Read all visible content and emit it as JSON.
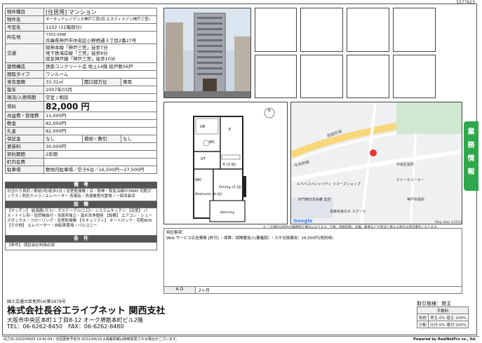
{
  "doc_id": "5577623",
  "property": {
    "type_label": "物件種目",
    "type_value": "[住居用] マンション",
    "name_label": "物件名",
    "name_value": "オーキッドレジデンス神戸三宮(旧:エスティメゾン神戸三宮)",
    "room_label": "号室名",
    "room_value": "1102 (11階部分)",
    "addr_label": "所在地",
    "addr_zip": "〒651-0088",
    "addr_value": "兵庫県神戸市中央区小野柄通３丁目2番27号",
    "transit_label": "交通",
    "transit": [
      "阪神本線「神戸三宮」徒歩7分",
      "地下鉄海岸線「三宮」徒歩8分",
      "阪急神戸線「神戸三宮」徒歩10分"
    ],
    "structure_label": "建物構造",
    "structure_value": "鉄筋コンクリート造 地上14階 総戸数56戸",
    "layout_label": "間取タイプ",
    "layout_value": "ワンルーム",
    "area_label": "専有面積",
    "area_value": "33.31㎡",
    "dir_label": "開口部方位",
    "dir_value": "東南",
    "built_label": "築年",
    "built_value": "2007年03月",
    "status_label": "現況/入居時期",
    "status_value": "空室 / 相談",
    "rent_label": "賃料",
    "rent_value": "82,000 円",
    "mgmt_label": "共益費・管理費",
    "mgmt_value": "11,000円",
    "deposit_label": "敷金",
    "deposit_value": "82,000円",
    "keymoney_label": "礼金",
    "keymoney_value": "82,000円",
    "guarantee_label": "保証金",
    "guarantee_value": "なし",
    "amort_label": "償却・敷引",
    "amort_value": "なし",
    "renew_label": "更新料",
    "renew_value": "30,000円",
    "contract_label": "契約期間",
    "contract_value": "2年間",
    "townfee_label": "町内会費",
    "townfee_value": "",
    "parking_label": "駐車場",
    "parking_value": "敷地内駐車場／空き6台／16,500円～27,500円"
  },
  "sections": {
    "remarks_title": "備　考",
    "remarks_text": "日当たり良好 / 駅前(地)徒歩1分 / 浴室乾燥機 / 沿・阪神・阪急沿線の3WAY 宅配ボックス / 防犯カメラ / エレベーター 各階有 / 洗濯機室内置場 / 一部改装済",
    "facilities_title": "設　備",
    "facilities_text": "【キッチン】 給湯器(ガス)・ガステーブル(二口)・システムキッチン 【浴室】 バス・トイレ別・追焚機能付・洗面所独立・温水洗浄便座 【設備】 エアコン・シューズボックス・フローリング・浴室乾燥機 【セキュリティ】 オートロック・宅配BOX 【その他】 エレベーター・自転車置場・バルコニー",
    "conditions_title": "条　件",
    "conditions_text": "【条件】 保証会社利用必須"
  },
  "floorplan": {
    "bedroom": "Bedroom\n(4.0J)",
    "dining": "Dining\n(5.5J)",
    "kitchen": "K (1.5J)",
    "balcony": "Balcony",
    "ub": "UB",
    "wc": "WC",
    "ut": "UT",
    "wic": "WIC",
    "entrance": "E",
    "compass": "N"
  },
  "map": {
    "labels": [
      "西国街道",
      "中央幹線",
      "ルベベスペシャリティ\nリマーズショップ",
      "ドトールコーヒー",
      "NTT西日本兵庫\n支店",
      "青森未来の子\nスクール",
      "神戸市役所",
      "中央区役所",
      "Google",
      "Map data ©2023"
    ],
    "copyright": "Map data ©2023"
  },
  "map_note": "※ この資料は物件の概略紹介資料になります。写真、間取図面、設備、概要などが現況と異なる場合は現況優先となります。",
  "remarks_box": {
    "label": "特記事項：",
    "text": "Web サービス広告費無 [許可] ・保険：保険要加入(要確認) ・カギ交換費用：16,500円(契約時)"
  },
  "ad": {
    "label": "A D",
    "value": "2ヶ月"
  },
  "side_tab": [
    "業",
    "務",
    "情",
    "報"
  ],
  "company": {
    "license": "国土交通大臣免許(4)第3479号",
    "name": "株式会社長谷工ライブネット 関西支社",
    "address": "大阪市中央区本町１丁目8-12 オーク堺筋本町ビル2階",
    "tel": "TEL：06-6262-8450　FAX：06-6262-8480"
  },
  "fees": {
    "title": "取引態様：貸主",
    "header": "手数料",
    "rows": [
      {
        "k": "負担",
        "v": "貸主:0%  借主:100%"
      },
      {
        "k": "分配",
        "v": "元付:0%  客付:100%"
      }
    ]
  },
  "footer": {
    "left": "出力日:2022/04/05 14:42:04 / 次回更新予定日:2022/04/19 ※掲載情報は随時変更される場合がございます。",
    "right": "Powered by RealNetPro co., ltd."
  },
  "colors": {
    "accent": "#2ea84a",
    "header_bg": "#555555"
  }
}
